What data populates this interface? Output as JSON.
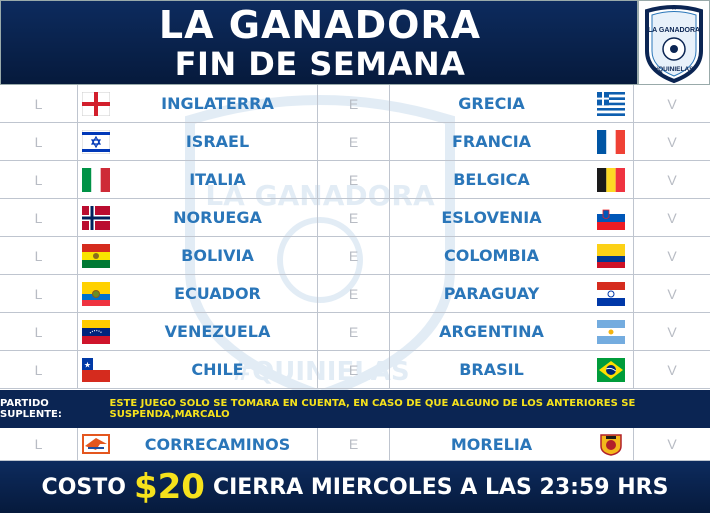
{
  "header": {
    "title_line1": "LA GANADORA",
    "title_line2": "FIN DE SEMANA"
  },
  "logo": {
    "brand": "LA GANADORA",
    "hashtag": "#QUINIELAS"
  },
  "watermark": {
    "text": "LA GANADORA",
    "hashtag": "#QUINIELAS"
  },
  "columns": {
    "local": "L",
    "draw": "E",
    "visit": "V"
  },
  "matches": [
    {
      "home": "INGLATERRA",
      "home_flag": "england-flag",
      "away": "GRECIA",
      "away_flag": "greece-flag"
    },
    {
      "home": "ISRAEL",
      "home_flag": "israel-flag",
      "away": "FRANCIA",
      "away_flag": "france-flag"
    },
    {
      "home": "ITALIA",
      "home_flag": "italy-flag",
      "away": "BELGICA",
      "away_flag": "belgium-flag"
    },
    {
      "home": "NORUEGA",
      "home_flag": "norway-flag",
      "away": "ESLOVENIA",
      "away_flag": "slovenia-flag"
    },
    {
      "home": "BOLIVIA",
      "home_flag": "bolivia-flag",
      "away": "COLOMBIA",
      "away_flag": "colombia-flag"
    },
    {
      "home": "ECUADOR",
      "home_flag": "ecuador-flag",
      "away": "PARAGUAY",
      "away_flag": "paraguay-flag"
    },
    {
      "home": "VENEZUELA",
      "home_flag": "venezuela-flag",
      "away": "ARGENTINA",
      "away_flag": "argentina-flag"
    },
    {
      "home": "CHILE",
      "home_flag": "chile-flag",
      "away": "BRASIL",
      "away_flag": "brazil-flag"
    }
  ],
  "suplente": {
    "label": "PARTIDO SUPLENTE:",
    "message": "ESTE JUEGO SOLO SE TOMARA EN CUENTA, EN CASO DE QUE ALGUNO DE LOS ANTERIORES SE SUSPENDA,MARCALO"
  },
  "backup_match": {
    "home": "CORRECAMINOS",
    "home_flag": "correcaminos-crest",
    "away": "MORELIA",
    "away_flag": "morelia-crest"
  },
  "footer": {
    "cost_label": "COSTO",
    "price": "$20",
    "close_text": "CIERRA MIERCOLES A LAS 23:59 HRS"
  },
  "colors": {
    "navy": "#0b2553",
    "team_blue": "#2a76b9",
    "yellow": "#f6e21c"
  }
}
